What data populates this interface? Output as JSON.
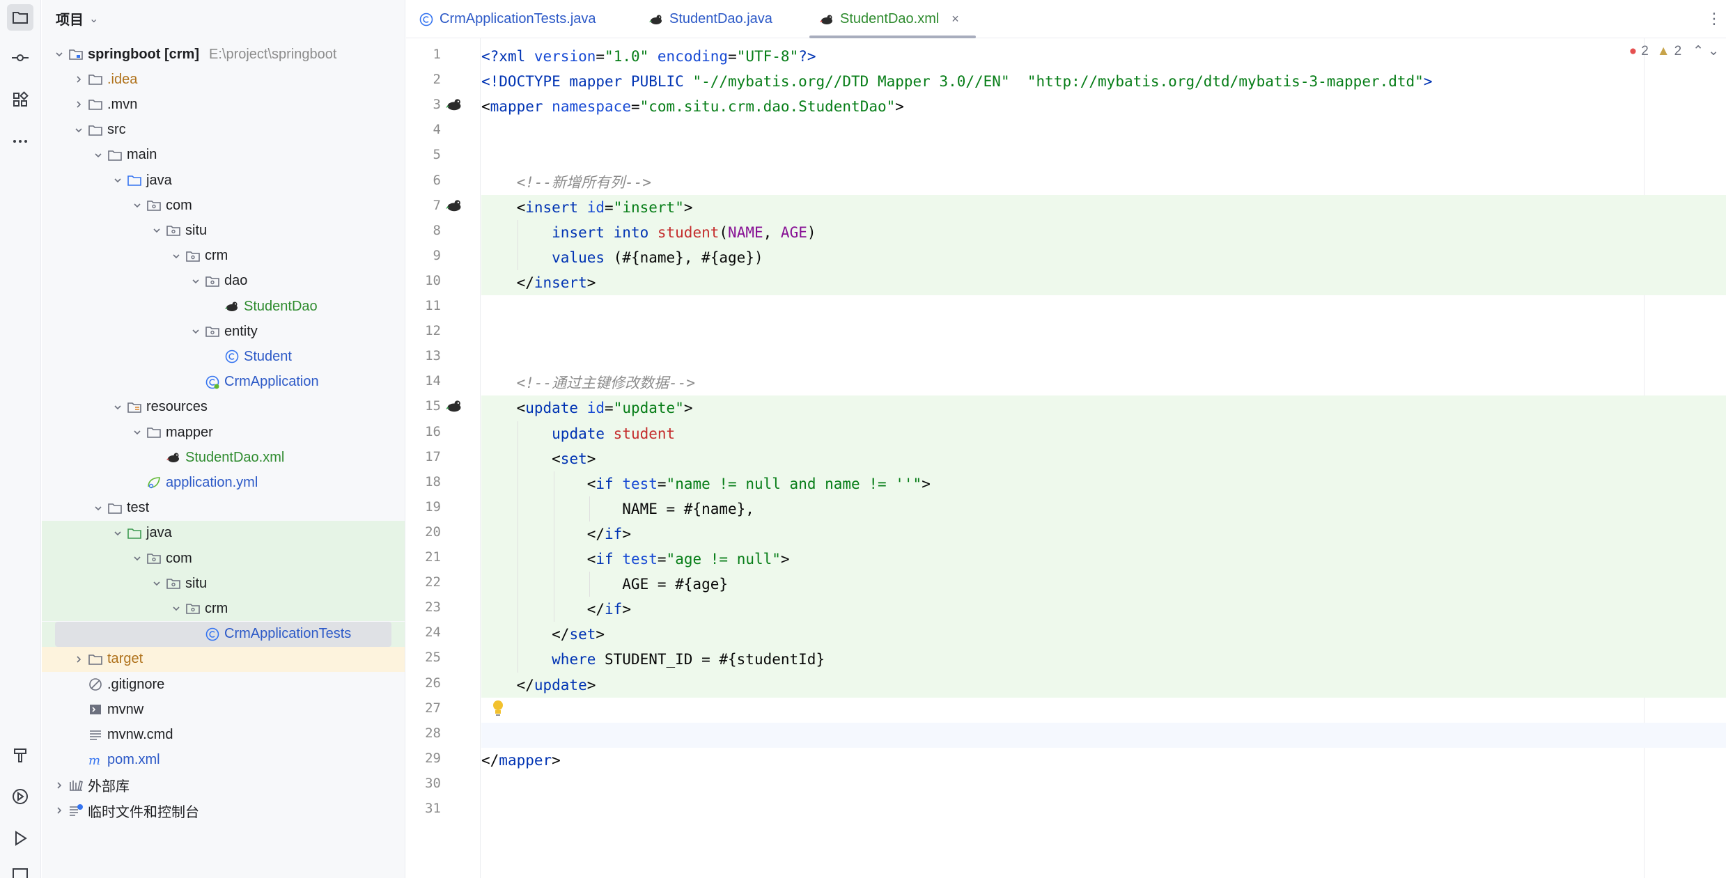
{
  "project_panel": {
    "title": "项目",
    "tree": [
      {
        "label": "springboot [crm]",
        "path": "E:\\project\\springboot",
        "icon": "module-folder-icon",
        "depth": 0,
        "expanded": true,
        "bold": true
      },
      {
        "label": ".idea",
        "icon": "folder-icon",
        "depth": 1,
        "expanded": false,
        "color": "gold"
      },
      {
        "label": ".mvn",
        "icon": "folder-icon",
        "depth": 1,
        "expanded": false
      },
      {
        "label": "src",
        "icon": "folder-icon",
        "depth": 1,
        "expanded": true
      },
      {
        "label": "main",
        "icon": "folder-icon",
        "depth": 2,
        "expanded": true
      },
      {
        "label": "java",
        "icon": "source-folder-icon",
        "depth": 3,
        "expanded": true
      },
      {
        "label": "com",
        "icon": "package-icon",
        "depth": 4,
        "expanded": true
      },
      {
        "label": "situ",
        "icon": "package-icon",
        "depth": 5,
        "expanded": true
      },
      {
        "label": "crm",
        "icon": "package-icon",
        "depth": 6,
        "expanded": true
      },
      {
        "label": "dao",
        "icon": "package-icon",
        "depth": 7,
        "expanded": true
      },
      {
        "label": "StudentDao",
        "icon": "mybatis-bird-icon",
        "depth": 8,
        "color": "green"
      },
      {
        "label": "entity",
        "icon": "package-icon",
        "depth": 7,
        "expanded": true
      },
      {
        "label": "Student",
        "icon": "class-icon",
        "depth": 8,
        "color": "blue"
      },
      {
        "label": "CrmApplication",
        "icon": "spring-class-icon",
        "depth": 7,
        "color": "blue"
      },
      {
        "label": "resources",
        "icon": "resources-folder-icon",
        "depth": 3,
        "expanded": true
      },
      {
        "label": "mapper",
        "icon": "folder-icon",
        "depth": 4,
        "expanded": true
      },
      {
        "label": "StudentDao.xml",
        "icon": "mybatis-bird-red-icon",
        "depth": 5,
        "color": "green"
      },
      {
        "label": "application.yml",
        "icon": "spring-leaf-icon",
        "depth": 4,
        "color": "blue"
      },
      {
        "label": "test",
        "icon": "folder-icon",
        "depth": 2,
        "expanded": true
      },
      {
        "label": "java",
        "icon": "test-folder-icon",
        "depth": 3,
        "expanded": true,
        "highlight": true
      },
      {
        "label": "com",
        "icon": "package-icon",
        "depth": 4,
        "expanded": true,
        "highlight": true
      },
      {
        "label": "situ",
        "icon": "package-icon",
        "depth": 5,
        "expanded": true,
        "highlight": true
      },
      {
        "label": "crm",
        "icon": "package-icon",
        "depth": 6,
        "expanded": true,
        "highlight": true
      },
      {
        "label": "CrmApplicationTests",
        "icon": "class-icon",
        "depth": 7,
        "color": "blue",
        "selected": true,
        "highlight": true
      },
      {
        "label": "target",
        "icon": "folder-icon",
        "depth": 1,
        "expanded": false,
        "color": "gold",
        "excluded": true
      },
      {
        "label": ".gitignore",
        "icon": "ignore-file-icon",
        "depth": 1
      },
      {
        "label": "mvnw",
        "icon": "shell-file-icon",
        "depth": 1
      },
      {
        "label": "mvnw.cmd",
        "icon": "text-file-icon",
        "depth": 1
      },
      {
        "label": "pom.xml",
        "icon": "maven-icon",
        "depth": 1,
        "color": "blue"
      },
      {
        "label": "外部库",
        "icon": "library-icon",
        "depth": 0,
        "expanded": false
      },
      {
        "label": "临时文件和控制台",
        "icon": "scratch-icon",
        "depth": 0,
        "expanded": false
      }
    ]
  },
  "tabs": [
    {
      "label": "CrmApplicationTests.java",
      "icon": "class-icon",
      "active": false
    },
    {
      "label": "StudentDao.java",
      "icon": "mybatis-bird-icon",
      "active": false
    },
    {
      "label": "StudentDao.xml",
      "icon": "mybatis-bird-red-icon",
      "active": true,
      "close": "×"
    }
  ],
  "inspections": {
    "errors": "2",
    "warnings": "2"
  },
  "code": {
    "line_numbers": [
      "1",
      "2",
      "3",
      "4",
      "5",
      "6",
      "7",
      "8",
      "9",
      "10",
      "11",
      "12",
      "13",
      "14",
      "15",
      "16",
      "17",
      "18",
      "19",
      "20",
      "21",
      "22",
      "23",
      "24",
      "25",
      "26",
      "27",
      "28",
      "29",
      "30",
      "31"
    ],
    "lines": [
      [
        [
          "tk-tag",
          "<?"
        ],
        [
          "tk-tag",
          "xml "
        ],
        [
          "tk-attr",
          "version"
        ],
        [
          "",
          "="
        ],
        [
          "tk-val",
          "\"1.0\""
        ],
        [
          "tk-attr",
          " encoding"
        ],
        [
          "",
          "="
        ],
        [
          "tk-val",
          "\"UTF-8\""
        ],
        [
          "tk-tag",
          "?>"
        ]
      ],
      [
        [
          "tk-tag",
          "<!DOCTYPE mapper PUBLIC "
        ],
        [
          "tk-val",
          "\"-//mybatis.org//DTD Mapper 3.0//EN\""
        ],
        [
          "",
          "  "
        ],
        [
          "tk-val",
          "\"http://mybatis.org/dtd/mybatis-3-mapper.dtd\""
        ],
        [
          "tk-tag",
          ">"
        ]
      ],
      [
        [
          "",
          "<"
        ],
        [
          "tk-tag",
          "mapper "
        ],
        [
          "tk-attr",
          "namespace"
        ],
        [
          "",
          "="
        ],
        [
          "tk-val",
          "\"com.situ.crm.dao.StudentDao\""
        ],
        [
          "",
          ">"
        ]
      ],
      [],
      [],
      [
        [
          "",
          "    "
        ],
        [
          "tk-cm",
          "<!--新增所有列-->"
        ]
      ],
      [
        [
          "",
          "    <"
        ],
        [
          "tk-tag",
          "insert "
        ],
        [
          "tk-attr",
          "id"
        ],
        [
          "",
          "="
        ],
        [
          "tk-val",
          "\"insert\""
        ],
        [
          "",
          ">"
        ]
      ],
      [
        [
          "",
          "        "
        ],
        [
          "tk-kw",
          "insert into "
        ],
        [
          "tk-tbl",
          "student"
        ],
        [
          "",
          "("
        ],
        [
          "tk-col",
          "NAME"
        ],
        [
          "",
          ", "
        ],
        [
          "tk-col",
          "AGE"
        ],
        [
          "",
          ")"
        ]
      ],
      [
        [
          "",
          "        "
        ],
        [
          "tk-kw",
          "values "
        ],
        [
          "",
          "(#{name}, #{age})"
        ]
      ],
      [
        [
          "",
          "    </"
        ],
        [
          "tk-tag",
          "insert"
        ],
        [
          "",
          ">"
        ]
      ],
      [],
      [],
      [],
      [
        [
          "",
          "    "
        ],
        [
          "tk-cm",
          "<!--通过主键修改数据-->"
        ]
      ],
      [
        [
          "",
          "    <"
        ],
        [
          "tk-tag",
          "update "
        ],
        [
          "tk-attr",
          "id"
        ],
        [
          "",
          "="
        ],
        [
          "tk-val",
          "\"update\""
        ],
        [
          "",
          ">"
        ]
      ],
      [
        [
          "",
          "        "
        ],
        [
          "tk-kw",
          "update "
        ],
        [
          "tk-tbl",
          "student"
        ]
      ],
      [
        [
          "",
          "        <"
        ],
        [
          "tk-tag",
          "set"
        ],
        [
          "",
          ">"
        ]
      ],
      [
        [
          "",
          "            <"
        ],
        [
          "tk-tag",
          "if "
        ],
        [
          "tk-attr",
          "test"
        ],
        [
          "",
          "="
        ],
        [
          "tk-val",
          "\"name != null and name != ''\""
        ],
        [
          "",
          ">"
        ]
      ],
      [
        [
          "",
          "                NAME = #{name},"
        ]
      ],
      [
        [
          "",
          "            </"
        ],
        [
          "tk-tag",
          "if"
        ],
        [
          "",
          ">"
        ]
      ],
      [
        [
          "",
          "            <"
        ],
        [
          "tk-tag",
          "if "
        ],
        [
          "tk-attr",
          "test"
        ],
        [
          "",
          "="
        ],
        [
          "tk-val",
          "\"age != null\""
        ],
        [
          "",
          ">"
        ]
      ],
      [
        [
          "",
          "                AGE = #{age}"
        ]
      ],
      [
        [
          "",
          "            </"
        ],
        [
          "tk-tag",
          "if"
        ],
        [
          "",
          ">"
        ]
      ],
      [
        [
          "",
          "        </"
        ],
        [
          "tk-tag",
          "set"
        ],
        [
          "",
          ">"
        ]
      ],
      [
        [
          "",
          "        "
        ],
        [
          "tk-kw",
          "where "
        ],
        [
          "",
          "STUDENT_ID = #{studentId}"
        ]
      ],
      [
        [
          "",
          "    </"
        ],
        [
          "tk-tag",
          "update"
        ],
        [
          "",
          ">"
        ]
      ],
      [],
      [],
      [
        [
          "",
          "</"
        ],
        [
          "tk-tag",
          "mapper"
        ],
        [
          "",
          ">"
        ]
      ],
      [],
      []
    ]
  }
}
